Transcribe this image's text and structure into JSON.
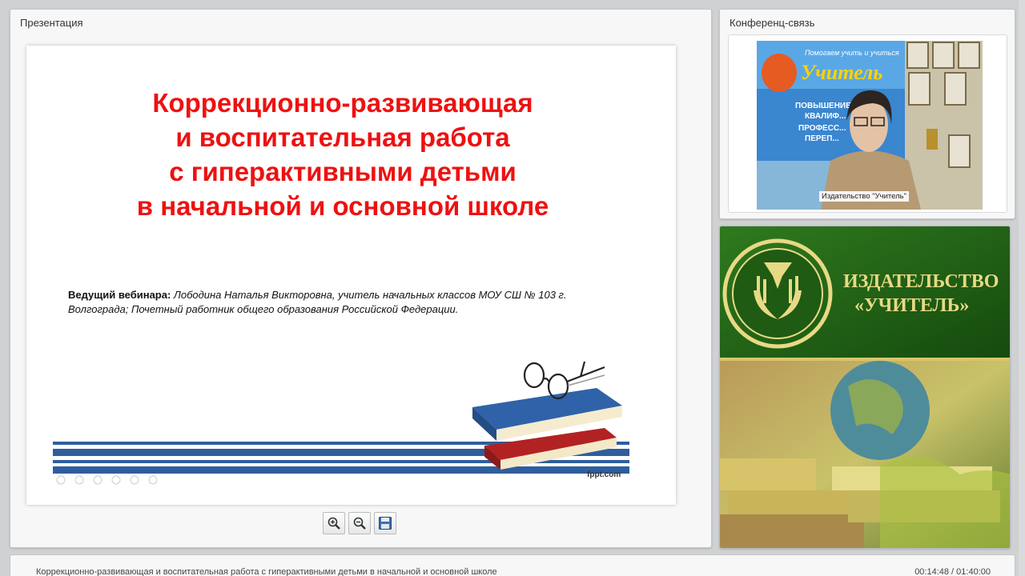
{
  "presentation": {
    "panel_title": "Презентация",
    "slide": {
      "title_lines": [
        "Коррекционно-развивающая",
        "и воспитательная работа",
        "с гиперактивными детьми",
        "в начальной и основной школе"
      ],
      "host_label": "Ведущий вебинара:",
      "host_text": " Лободина Наталья Викторовна, учитель начальных классов МОУ СШ № 103 г. Волгограда; Почетный работник общего образования Российской Федерации.",
      "watermark": "fppt.com"
    },
    "toolbar": {
      "zoom_in": "zoom-in",
      "zoom_out": "zoom-out",
      "save": "save"
    }
  },
  "conference": {
    "panel_title": "Конференц-связь",
    "video_label": "Издательство \"Учитель\"",
    "poster_tagline": "Помогаем учить и учиться",
    "poster_brand": "Учитель",
    "poster_lines": [
      "ПОВЫШЕНИЕ",
      "КВАЛИФ...",
      "ПРОФЕСС...",
      "ПЕРЕП..."
    ]
  },
  "banner": {
    "line1": "ИЗДАТЕЛЬСТВО",
    "line2": "«УЧИТЕЛЬ»"
  },
  "footer": {
    "title": "Коррекционно-развивающая и воспитательная работа с гиперактивными детьми в начальной и основной школе",
    "time": "00:14:48 / 01:40:00"
  },
  "colors": {
    "title_red": "#ee1111",
    "banner_green": "#1f5b13",
    "stripe_blue": "#2f5e9e"
  }
}
